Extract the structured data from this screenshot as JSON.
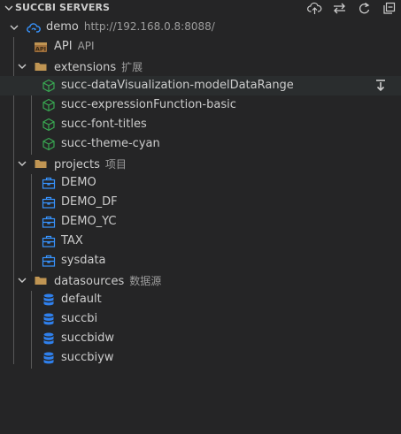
{
  "panel": {
    "title": "SUCCBI SERVERS",
    "toolbar": [
      "cloud-upload-icon",
      "sync-icon",
      "refresh-icon",
      "collapse-all-icon"
    ]
  },
  "server": {
    "name": "demo",
    "url": "http://192.168.0.8:8088/"
  },
  "api": {
    "label": "API",
    "desc": "API"
  },
  "extensions": {
    "label": "extensions",
    "desc": "扩展",
    "items": [
      "succ-dataVisualization-modelDataRange",
      "succ-expressionFunction-basic",
      "succ-font-titles",
      "succ-theme-cyan"
    ]
  },
  "projects": {
    "label": "projects",
    "desc": "项目",
    "items": [
      "DEMO",
      "DEMO_DF",
      "DEMO_YC",
      "TAX",
      "sysdata"
    ]
  },
  "datasources": {
    "label": "datasources",
    "desc": "数据源",
    "items": [
      "default",
      "succbi",
      "succbidw",
      "succbiyw"
    ]
  },
  "colors": {
    "background": "#252526",
    "hover": "#2a2d2e",
    "folder": "#c09553",
    "extension": "#39a852",
    "project": "#3794ff",
    "database": "#2f80ed",
    "cloud": "#3794ff"
  }
}
